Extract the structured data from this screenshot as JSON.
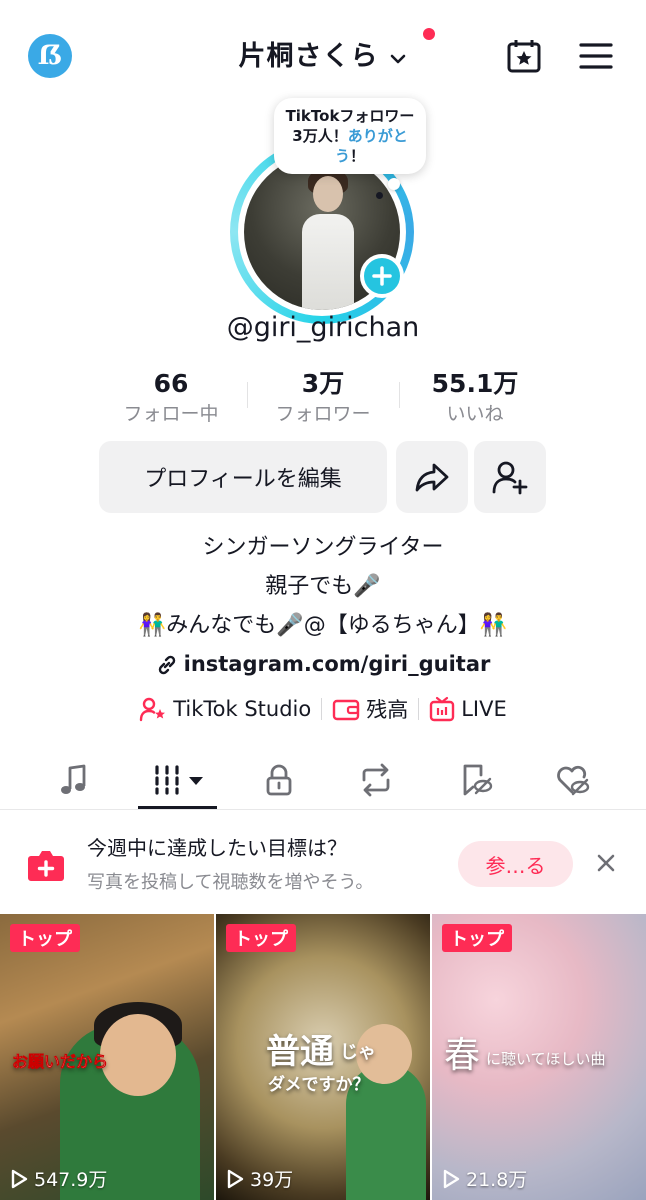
{
  "header": {
    "display_name": "片桐さくら",
    "has_notification_dot": true
  },
  "profile": {
    "bubble_part1": "TikTokフォロワー3万人！",
    "bubble_part2": "ありがとう",
    "bubble_part3": "！",
    "username": "@giri_girichan"
  },
  "stats": [
    {
      "value": "66",
      "label": "フォロー中"
    },
    {
      "value": "3万",
      "label": "フォロワー"
    },
    {
      "value": "55.1万",
      "label": "いいね"
    }
  ],
  "actions": {
    "edit_profile": "プロフィールを編集"
  },
  "bio": {
    "line1": "シンガーソングライター",
    "line2": "親子でも🎤",
    "line3": "👫みんなでも🎤@【ゆるちゃん】👫",
    "link": "instagram.com/giri_guitar"
  },
  "quick_links": [
    {
      "label": "TikTok Studio",
      "icon": "person-star-icon"
    },
    {
      "label": "残高",
      "icon": "wallet-icon"
    },
    {
      "label": "LIVE",
      "icon": "live-tv-icon"
    }
  ],
  "tabs": [
    {
      "icon": "music-note-icon"
    },
    {
      "icon": "videos-grid-icon",
      "active": true
    },
    {
      "icon": "lock-icon"
    },
    {
      "icon": "repost-icon"
    },
    {
      "icon": "bookmark-hidden-icon"
    },
    {
      "icon": "liked-hidden-icon"
    }
  ],
  "promo": {
    "title": "今週中に達成したい目標は？",
    "subtitle": "写真を投稿して視聴数を増やそう。",
    "cta": "参…る"
  },
  "videos": [
    {
      "tag": "トップ",
      "views": "547.9万",
      "overlay": "お願いだから"
    },
    {
      "tag": "トップ",
      "views": "39万",
      "overlay1": "普通",
      "overlay2": "じゃ",
      "overlay3": "ダメですか？"
    },
    {
      "tag": "トップ",
      "views": "21.8万",
      "overlay1": "春",
      "overlay2": "に聴いてほしい曲"
    }
  ],
  "colors": {
    "accent": "#fe2c55",
    "ring": "#25c4e0",
    "link_blue": "#3a9bd5",
    "text_primary": "#161823",
    "text_secondary": "#8a8b91"
  }
}
